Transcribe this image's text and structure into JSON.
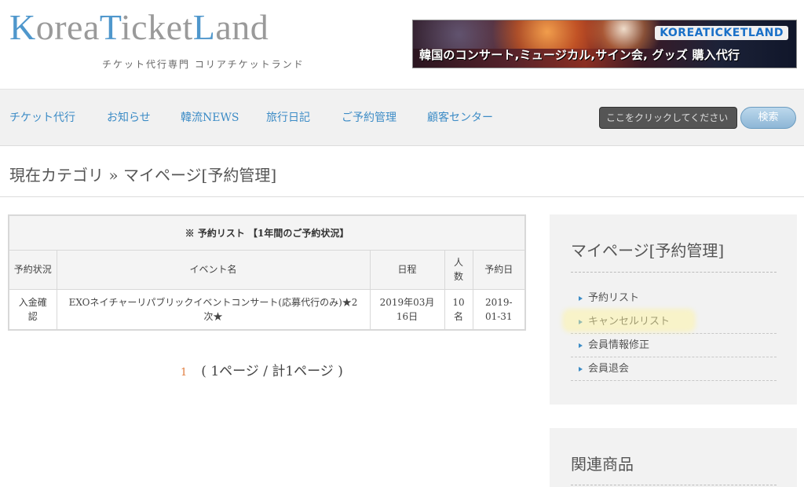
{
  "header": {
    "logo_parts": [
      "K",
      "orea",
      "T",
      "icket",
      "L",
      "and"
    ],
    "tagline": "チケット代行専門 コリアチケットランド",
    "banner_brand": "KOREATICKETLAND",
    "banner_text": "韓国のコンサート,ミュージカル,サイン会, グッズ 購入代行"
  },
  "nav": {
    "items": [
      "チケット代行",
      "お知らせ",
      "韓流NEWS",
      "旅行日記",
      "ご予約管理",
      "顧客センター"
    ],
    "search_placeholder": "ここをクリックしてください",
    "search_button": "検索"
  },
  "breadcrumb": "現在カテゴリ » マイページ[予約管理]",
  "reservation_table": {
    "caption": "※ 予約リスト 【1年間のご予約状況】",
    "headers": [
      "予約状況",
      "イベント名",
      "日程",
      "人数",
      "予約日"
    ],
    "rows": [
      {
        "status": "入金確認",
        "event": "EXOネイチャーリパブリックイベントコンサート(応募代行のみ)★2次★",
        "schedule": "2019年03月16日",
        "people": "10名",
        "reserved": "2019-01-31"
      }
    ]
  },
  "pagination": {
    "current": "1",
    "summary": "( 1ページ / 計1ページ )"
  },
  "sidebar": {
    "title": "マイページ[予約管理]",
    "items": [
      "予約リスト",
      "キャンセルリスト",
      "会員情報修正",
      "会員退会"
    ],
    "highlighted_item": "キャンセルリスト",
    "related_title": "関連商品"
  },
  "colors": {
    "link_blue": "#3d8cc6",
    "logo_gray": "#9a9a9a",
    "pager_orange": "#e07a3a",
    "highlight_yellow": "#fff596"
  }
}
